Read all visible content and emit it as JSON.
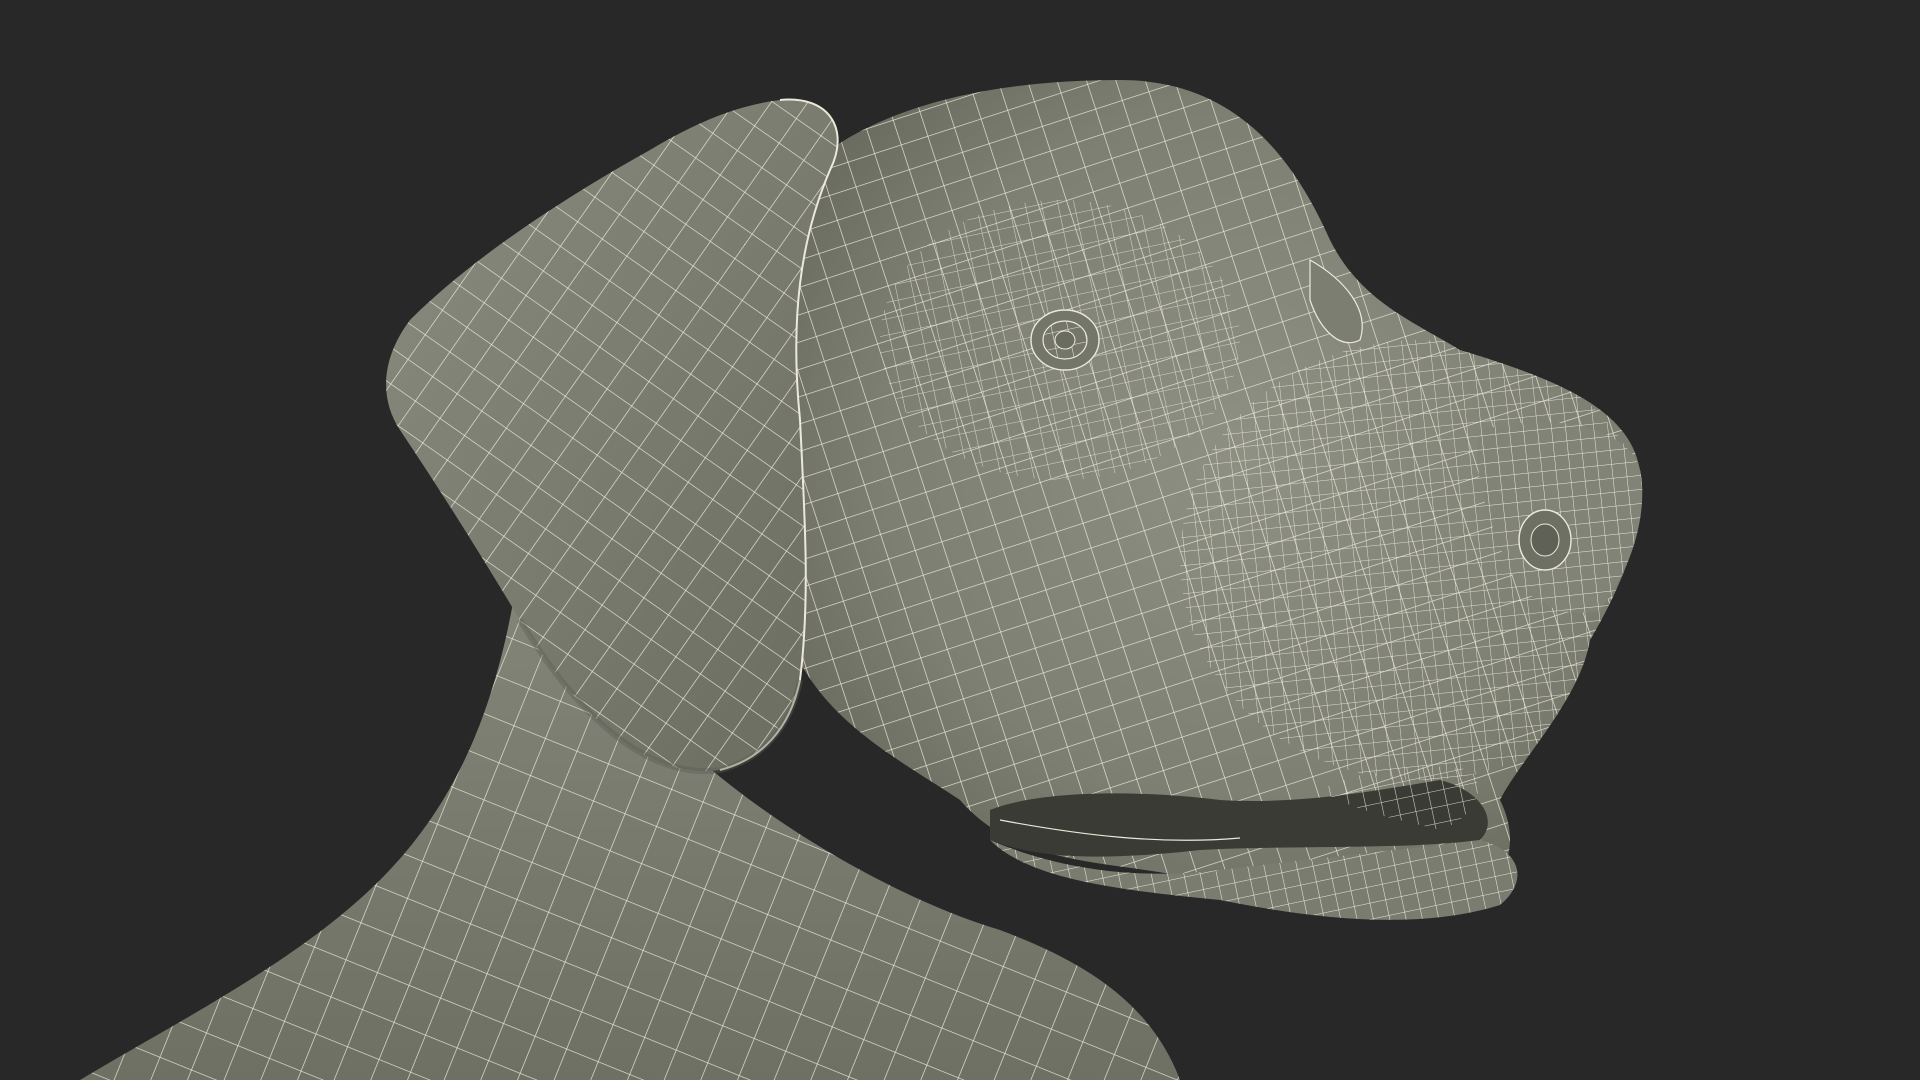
{
  "scene": {
    "subject": "dog-head-wireframe",
    "colors": {
      "background": "#282828",
      "surface": "#838577",
      "surface_shadow": "#5f6156",
      "surface_highlight": "#9a9b8e",
      "wire": "#ece9da",
      "mouth_interior": "#3a3b34"
    }
  }
}
